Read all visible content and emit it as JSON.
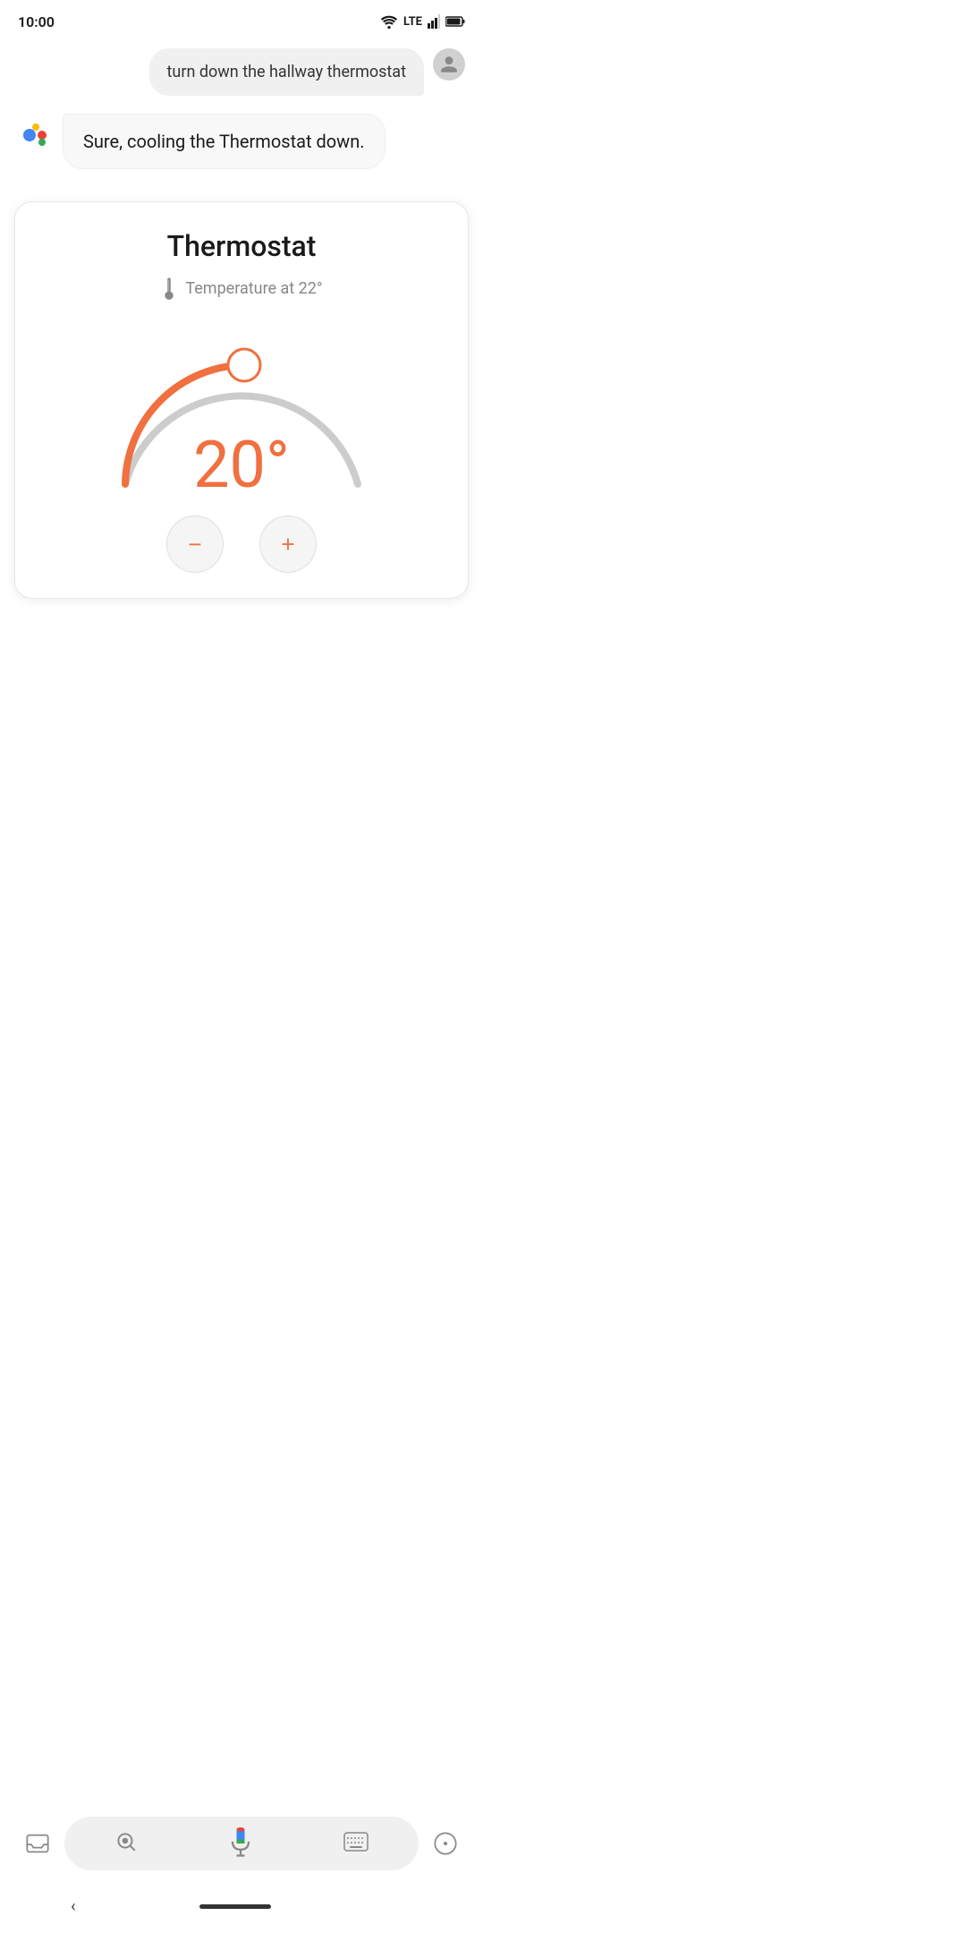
{
  "statusBar": {
    "time": "10:00",
    "wifi": true,
    "lte": "LTE",
    "signal": true,
    "battery": true
  },
  "userMessage": {
    "text": "turn down the hallway thermostat"
  },
  "assistantMessage": {
    "text": "Sure, cooling the Thermostat down."
  },
  "thermostat": {
    "title": "Thermostat",
    "tempLabel": "Temperature at 22°",
    "currentTemp": "20°",
    "accentColor": "#F07040",
    "arcColor": "#F07040",
    "arcBgColor": "#cccccc",
    "handleColor": "#F07040"
  },
  "controls": {
    "decreaseLabel": "−",
    "increaseLabel": "+"
  },
  "bottomBar": {
    "lensIconLabel": "lens-icon",
    "micIconLabel": "mic-icon",
    "keyboardIconLabel": "keyboard-icon",
    "compassIconLabel": "compass-icon",
    "assistantIconLabel": "assistant-icon"
  }
}
